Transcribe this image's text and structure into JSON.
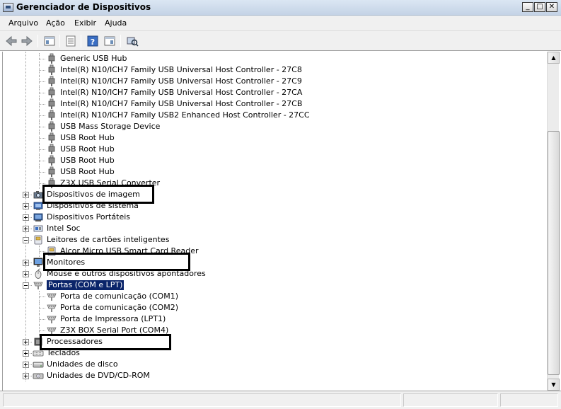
{
  "window": {
    "title": "Gerenciador de Dispositivos"
  },
  "window_buttons": {
    "minimize": "_",
    "maximize": "□",
    "close": "✕"
  },
  "menu": [
    "Arquivo",
    "Ação",
    "Exibir",
    "Ajuda"
  ],
  "toolbar": {
    "buttons": [
      "back-arrow-icon",
      "forward-arrow-icon",
      "console-tree-icon",
      "properties-icon",
      "help-icon",
      "device-view-icon",
      "scan-hardware-icon"
    ]
  },
  "scrollbar": {
    "up": "▲",
    "down": "▼",
    "position_fraction": 0.25
  },
  "tree": {
    "usb_items": [
      "Generic USB Hub",
      "Intel(R) N10/ICH7 Family USB Universal Host Controller - 27C8",
      "Intel(R) N10/ICH7 Family USB Universal Host Controller - 27C9",
      "Intel(R) N10/ICH7 Family USB Universal Host Controller - 27CA",
      "Intel(R) N10/ICH7 Family USB Universal Host Controller - 27CB",
      "Intel(R) N10/ICH7 Family USB2 Enhanced Host Controller - 27CC",
      "USB Mass Storage Device",
      "USB Root Hub",
      "USB Root Hub",
      "USB Root Hub",
      "USB Root Hub",
      "Z3X USB Serial Converter"
    ],
    "categories_a": [
      {
        "label": "Dispositivos de imagem",
        "icon": "camera-icon"
      },
      {
        "label": "Dispositivos de sistema",
        "icon": "system-device-icon"
      },
      {
        "label": "Dispositivos Portáteis",
        "icon": "portable-device-icon"
      },
      {
        "label": "Intel Soc",
        "icon": "chip-icon"
      }
    ],
    "smartcard": {
      "label": "Leitores de cartões inteligentes",
      "child": "Alcor Micro USB Smart Card Reader"
    },
    "categories_b": [
      {
        "label": "Monitores",
        "icon": "monitor-icon"
      },
      {
        "label": "Mouse e outros dispositivos apontadores",
        "icon": "mouse-icon"
      }
    ],
    "ports": {
      "label": "Portas (COM e LPT)",
      "children": [
        "Porta de comunicação (COM1)",
        "Porta de comunicação (COM2)",
        "Porta de Impressora (LPT1)",
        "Z3X BOX Serial Port (COM4)"
      ]
    },
    "categories_c": [
      {
        "label": "Processadores",
        "icon": "processor-icon"
      },
      {
        "label": "Teclados",
        "icon": "keyboard-icon"
      },
      {
        "label": "Unidades de disco",
        "icon": "disk-drive-icon"
      },
      {
        "label": "Unidades de DVD/CD-ROM",
        "icon": "dvd-drive-icon"
      }
    ]
  },
  "colors": {
    "selection": "#0a246a",
    "annotation_box": "#000000"
  }
}
